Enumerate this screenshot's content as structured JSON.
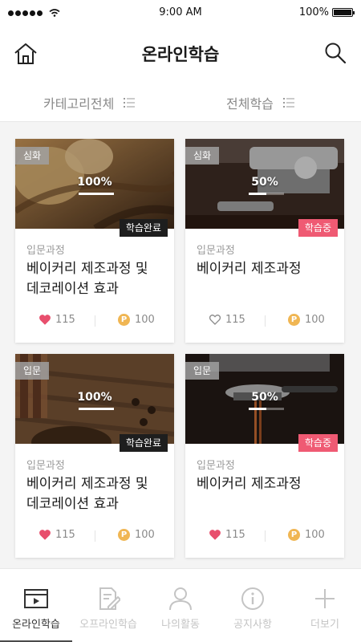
{
  "status_bar": {
    "time": "9:00 AM",
    "battery": "100%"
  },
  "header": {
    "title": "온라인학습",
    "home_icon": "home-icon",
    "search_icon": "search-icon"
  },
  "filters": [
    {
      "label": "카테고리전체",
      "icon": "menu-list-icon"
    },
    {
      "label": "전체학습",
      "icon": "menu-list-icon"
    }
  ],
  "colors": {
    "accent_pink": "#ef5a73",
    "complete_black": "#1e1e1e",
    "coin": "#f0b653",
    "heart": "#e84f6d"
  },
  "courses": [
    {
      "level": "심화",
      "progress_label": "100%",
      "progress": 1.0,
      "status": "학습완료",
      "status_type": "complete",
      "category": "입문과정",
      "title_line1": "베이커리 제조과정 및",
      "title_line2": "데코레이션 효과",
      "likes": "115",
      "liked": true,
      "points": "100",
      "coin_label": "P"
    },
    {
      "level": "심화",
      "progress_label": "50%",
      "progress": 0.5,
      "status": "학습중",
      "status_type": "in-progress",
      "category": "입문과정",
      "title_line1": "베이커리 제조과정",
      "title_line2": "",
      "likes": "115",
      "liked": false,
      "points": "100",
      "coin_label": "P"
    },
    {
      "level": "입문",
      "progress_label": "100%",
      "progress": 1.0,
      "status": "학습완료",
      "status_type": "complete",
      "category": "입문과정",
      "title_line1": "베이커리 제조과정 및",
      "title_line2": "데코레이션 효과",
      "likes": "115",
      "liked": true,
      "points": "100",
      "coin_label": "P"
    },
    {
      "level": "입문",
      "progress_label": "50%",
      "progress": 0.5,
      "status": "학습중",
      "status_type": "in-progress",
      "category": "입문과정",
      "title_line1": "베이커리 제조과정",
      "title_line2": "",
      "likes": "115",
      "liked": true,
      "points": "100",
      "coin_label": "P"
    }
  ],
  "tabs": [
    {
      "label": "온라인학습",
      "icon": "video-player-icon",
      "active": true
    },
    {
      "label": "오프라인학습",
      "icon": "document-edit-icon",
      "active": false
    },
    {
      "label": "나의활동",
      "icon": "user-icon",
      "active": false
    },
    {
      "label": "공지사항",
      "icon": "info-icon",
      "active": false
    },
    {
      "label": "더보기",
      "icon": "plus-icon",
      "active": false
    }
  ]
}
